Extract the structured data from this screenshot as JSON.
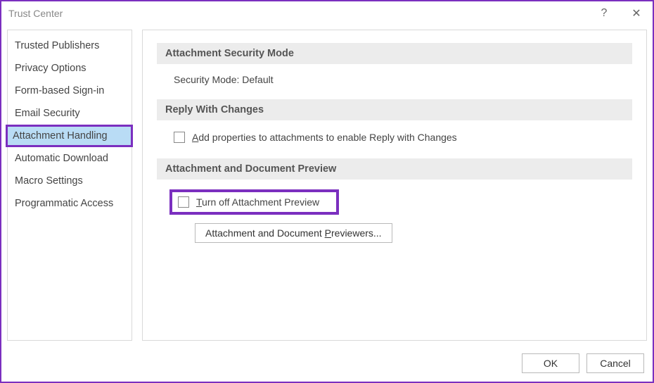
{
  "window": {
    "title": "Trust Center",
    "help_glyph": "?",
    "close_glyph": "✕"
  },
  "sidebar": {
    "items": [
      {
        "label": "Trusted Publishers",
        "selected": false
      },
      {
        "label": "Privacy Options",
        "selected": false
      },
      {
        "label": "Form-based Sign-in",
        "selected": false
      },
      {
        "label": "Email Security",
        "selected": false
      },
      {
        "label": "Attachment Handling",
        "selected": true
      },
      {
        "label": "Automatic Download",
        "selected": false
      },
      {
        "label": "Macro Settings",
        "selected": false
      },
      {
        "label": "Programmatic Access",
        "selected": false
      }
    ]
  },
  "main": {
    "sections": {
      "attachment_security": {
        "header": "Attachment Security Mode",
        "text": "Security Mode: Default"
      },
      "reply_with_changes": {
        "header": "Reply With Changes",
        "checkbox_prefix": "A",
        "checkbox_rest": "dd properties to attachments to enable Reply with Changes"
      },
      "preview": {
        "header": "Attachment and Document Preview",
        "checkbox_prefix": "T",
        "checkbox_rest": "urn off Attachment Preview",
        "button_before": "Attachment and Document ",
        "button_u": "P",
        "button_after": "reviewers..."
      }
    }
  },
  "footer": {
    "ok": "OK",
    "cancel": "Cancel"
  }
}
